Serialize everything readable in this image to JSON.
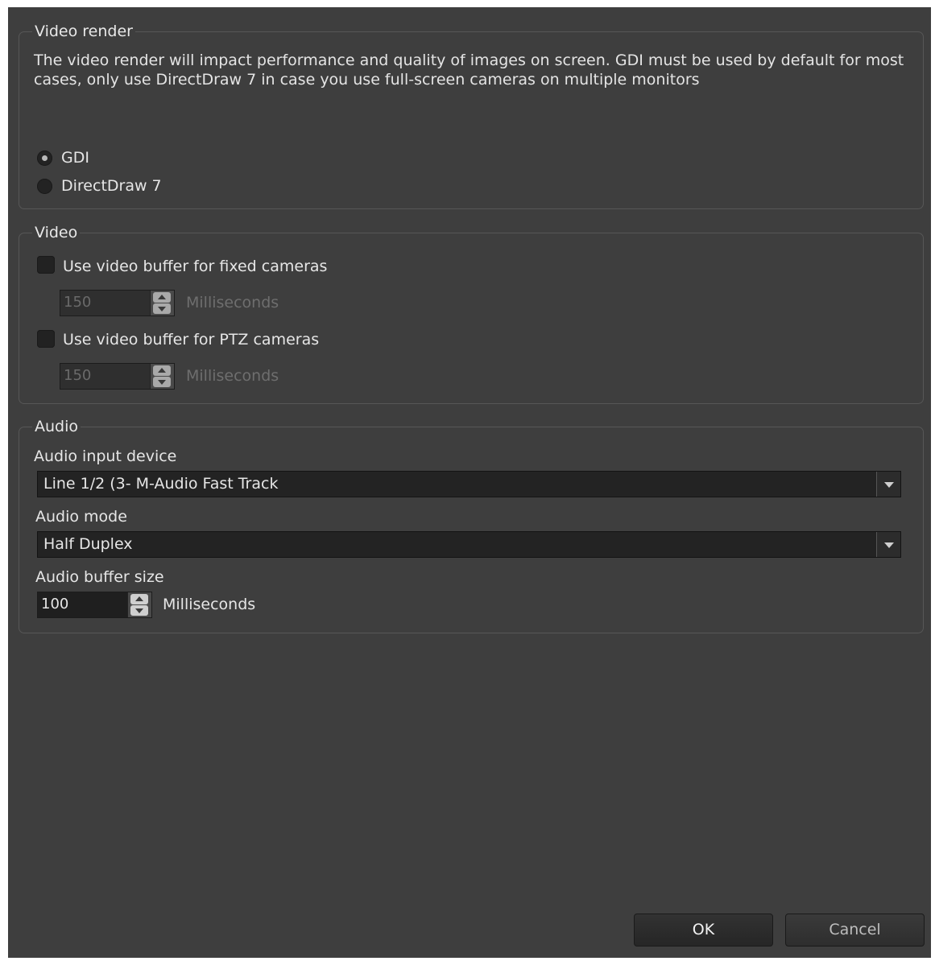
{
  "video_render": {
    "legend": "Video render",
    "description": "The video render will impact performance and quality of images on screen. GDI must be used by default for most cases, only use DirectDraw 7 in case you use full-screen cameras on multiple monitors",
    "options": [
      {
        "label": "GDI",
        "selected": true
      },
      {
        "label": "DirectDraw 7",
        "selected": false
      }
    ]
  },
  "video": {
    "legend": "Video",
    "fixed": {
      "label": "Use video buffer for fixed cameras",
      "checked": false,
      "value": "150",
      "unit": "Milliseconds"
    },
    "ptz": {
      "label": "Use video buffer for PTZ cameras",
      "checked": false,
      "value": "150",
      "unit": "Milliseconds"
    }
  },
  "audio": {
    "legend": "Audio",
    "input_device_label": "Audio input device",
    "input_device_value": "Line 1/2 (3- M-Audio Fast Track",
    "mode_label": "Audio mode",
    "mode_value": "Half Duplex",
    "buffer_label": "Audio buffer size",
    "buffer_value": "100",
    "buffer_unit": "Milliseconds"
  },
  "buttons": {
    "ok": "OK",
    "cancel": "Cancel"
  },
  "icons": {
    "spin": "spin-up-down-icon",
    "dropdown": "chevron-down-icon"
  }
}
